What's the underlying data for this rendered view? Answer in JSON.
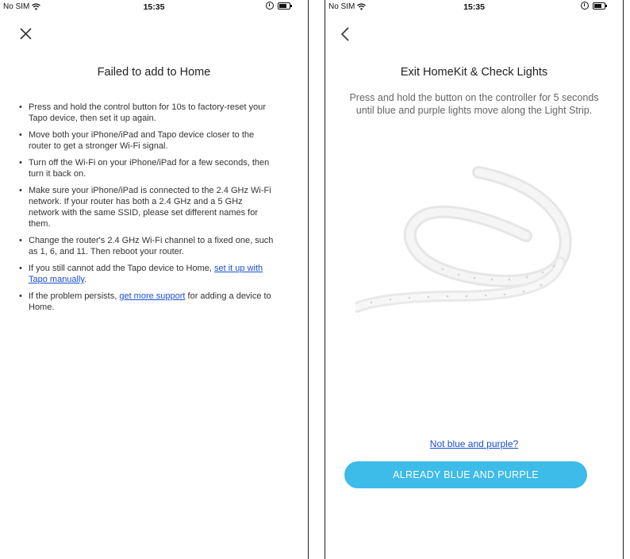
{
  "left_screen": {
    "status": {
      "carrier": "No SIM",
      "time": "15:35"
    },
    "close_icon": "close-icon",
    "title": "Failed to add to Home",
    "bullets": {
      "b1": "Press and hold the control button for 10s to factory-reset your Tapo device, then set it up again.",
      "b2": "Move both your iPhone/iPad and Tapo device closer to the router to get a stronger Wi-Fi signal.",
      "b3": "Turn off the Wi-Fi on your iPhone/iPad for a few seconds, then turn it back on.",
      "b4": "Make sure your iPhone/iPad is connected to the 2.4 GHz Wi-Fi network. If your router has both a 2.4 GHz and a 5 GHz network with the same SSID, please set different names for them.",
      "b5": "Change the router's 2.4 GHz Wi-Fi channel to a fixed one, such as 1, 6, and 11. Then reboot your router.",
      "b6_prefix": "If you still cannot add the Tapo device to Home, ",
      "b6_link": "set it up with Tapo manually",
      "b6_suffix": ".",
      "b7_prefix": "If the problem persists, ",
      "b7_link": "get more support",
      "b7_suffix": " for adding a device to Home."
    }
  },
  "right_screen": {
    "status": {
      "carrier": "No SIM",
      "time": "15:35"
    },
    "back_icon": "chevron-left-icon",
    "title": "Exit HomeKit & Check Lights",
    "subtitle": "Press and hold the button on the controller for 5 seconds until blue and purple lights move along the Light Strip.",
    "image": "light-strip-illustration",
    "not_colors_link": "Not blue and purple?",
    "primary_button": "ALREADY BLUE AND PURPLE",
    "accent_color": "#3dbbe9",
    "link_color": "#1a4fd1"
  }
}
